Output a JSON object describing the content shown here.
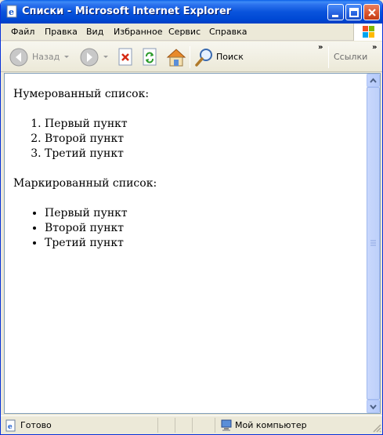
{
  "window": {
    "title": "Списки - Microsoft Internet Explorer"
  },
  "menu": {
    "items": [
      {
        "label": "Файл"
      },
      {
        "label": "Правка"
      },
      {
        "label": "Вид"
      },
      {
        "label": "Избранное"
      },
      {
        "label": "Сервис"
      },
      {
        "label": "Справка"
      }
    ]
  },
  "toolbar": {
    "back_label": "Назад",
    "search_label": "Поиск",
    "links_label": "Ссылки",
    "chevron": "»"
  },
  "page": {
    "ordered_heading": "Нумерованный список:",
    "ordered_items": [
      "Первый пункт",
      "Второй пункт",
      "Третий пункт"
    ],
    "unordered_heading": "Маркированный список:",
    "unordered_items": [
      "Первый пункт",
      "Второй пункт",
      "Третий пункт"
    ]
  },
  "status": {
    "text": "Готово",
    "zone": "Мой компьютер"
  },
  "icons": {
    "back": "back-arrow-icon",
    "forward": "forward-arrow-icon",
    "stop": "stop-icon",
    "refresh": "refresh-icon",
    "home": "home-icon",
    "search": "search-icon"
  }
}
